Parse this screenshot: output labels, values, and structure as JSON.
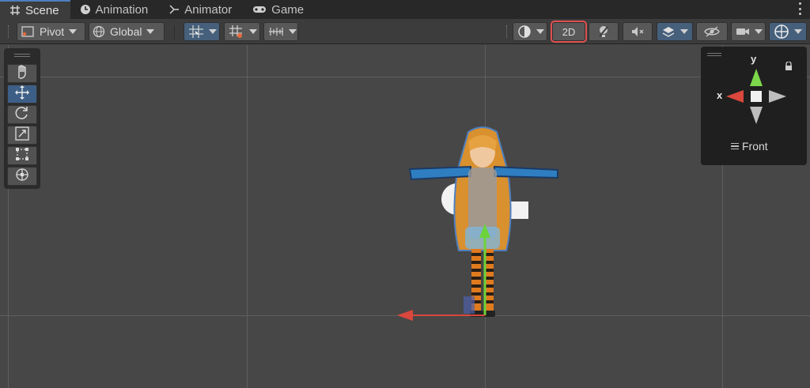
{
  "tabs": [
    {
      "label": "Scene",
      "icon": "grid-hash-icon",
      "active": true
    },
    {
      "label": "Animation",
      "icon": "clock-icon",
      "active": false
    },
    {
      "label": "Animator",
      "icon": "animator-graph-icon",
      "active": false
    },
    {
      "label": "Game",
      "icon": "gamepad-icon",
      "active": false
    }
  ],
  "toolbar": {
    "pivot_label": "Pivot",
    "global_label": "Global",
    "mode_2d_label": "2D"
  },
  "gizmo": {
    "axis_y": "y",
    "axis_x": "x",
    "view_label": "Front"
  },
  "colors": {
    "accent_blue": "#46607c",
    "selected_tool": "#3d5f87",
    "highlight_red": "#e05050",
    "axis_x": "#d9473d",
    "axis_y": "#6cd33a"
  }
}
